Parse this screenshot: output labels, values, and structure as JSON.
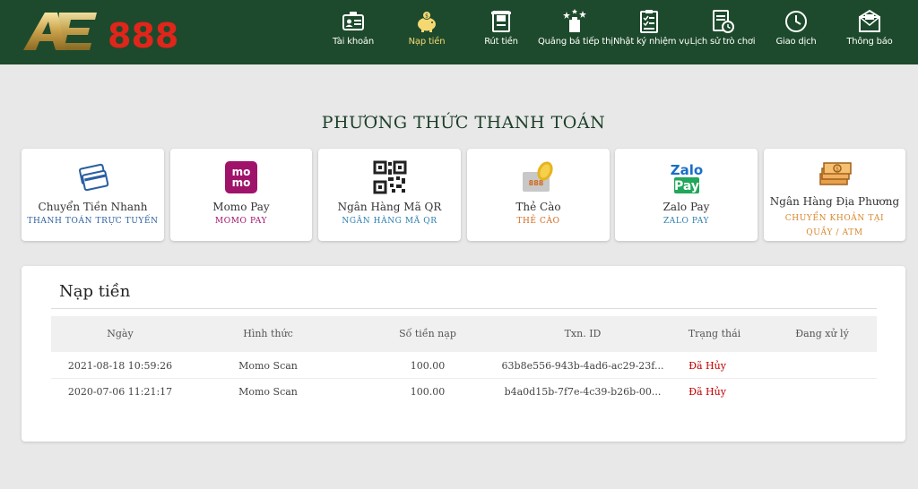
{
  "brand": {
    "logo_text_a": "AE",
    "logo_text_b": "888"
  },
  "nav": [
    {
      "label": "Tài khoản",
      "icon": "account-card-icon",
      "active": false
    },
    {
      "label": "Nạp tiền",
      "icon": "piggy-bank-icon",
      "active": true
    },
    {
      "label": "Rút tiền",
      "icon": "withdraw-icon",
      "active": false
    },
    {
      "label": "Quảng bá tiếp thị",
      "icon": "promotion-icon",
      "active": false
    },
    {
      "label": "Nhật ký nhiệm vụ",
      "icon": "task-log-icon",
      "active": false
    },
    {
      "label": "Lịch sử trò chơi",
      "icon": "game-history-icon",
      "active": false
    },
    {
      "label": "Giao dịch",
      "icon": "clock-icon",
      "active": false
    },
    {
      "label": "Thông báo",
      "icon": "envelope-icon",
      "active": false
    }
  ],
  "page_title": "PHƯƠNG THỨC THANH TOÁN",
  "payment_methods": [
    {
      "title": "Chuyển Tiền Nhanh",
      "subtitle": "THANH TOÁN TRỰC TUYẾN",
      "icon": "credit-cards-icon",
      "subtitle_color": "#2a5fa0"
    },
    {
      "title": "Momo Pay",
      "subtitle": "MOMO PAY",
      "icon": "momo-logo-icon",
      "subtitle_color": "#a0136b"
    },
    {
      "title": "Ngân Hàng Mã QR",
      "subtitle": "NGÂN HÀNG MÃ QR",
      "icon": "qr-code-icon",
      "subtitle_color": "#2a7fb0"
    },
    {
      "title": "Thẻ Cào",
      "subtitle": "THẺ CÀO",
      "icon": "scratch-card-icon",
      "subtitle_color": "#d2691e"
    },
    {
      "title": "Zalo Pay",
      "subtitle": "ZALO PAY",
      "icon": "zalo-pay-icon",
      "subtitle_color": "#2a7fb0"
    },
    {
      "title": "Ngân Hàng Địa Phương",
      "subtitle": "CHUYỂN KHOẢN TẠI QUẦY / ATM",
      "icon": "cash-stack-icon",
      "subtitle_color": "#d8862a"
    }
  ],
  "deposit": {
    "title": "Nạp tiền",
    "columns": [
      "Ngày",
      "Hình thức",
      "Số tiền nạp",
      "Txn. ID",
      "Trạng thái",
      "Đang xử lý"
    ],
    "rows": [
      {
        "date": "2021-08-18 10:59:26",
        "method": "Momo Scan",
        "amount": "100.00",
        "txn": "63b8e556-943b-4ad6-ac29-23f...",
        "status": "Đã Hủy",
        "processing": ""
      },
      {
        "date": "2020-07-06 11:21:17",
        "method": "Momo Scan",
        "amount": "100.00",
        "txn": "b4a0d15b-7f7e-4c39-b26b-00...",
        "status": "Đã Hủy",
        "processing": ""
      }
    ]
  }
}
